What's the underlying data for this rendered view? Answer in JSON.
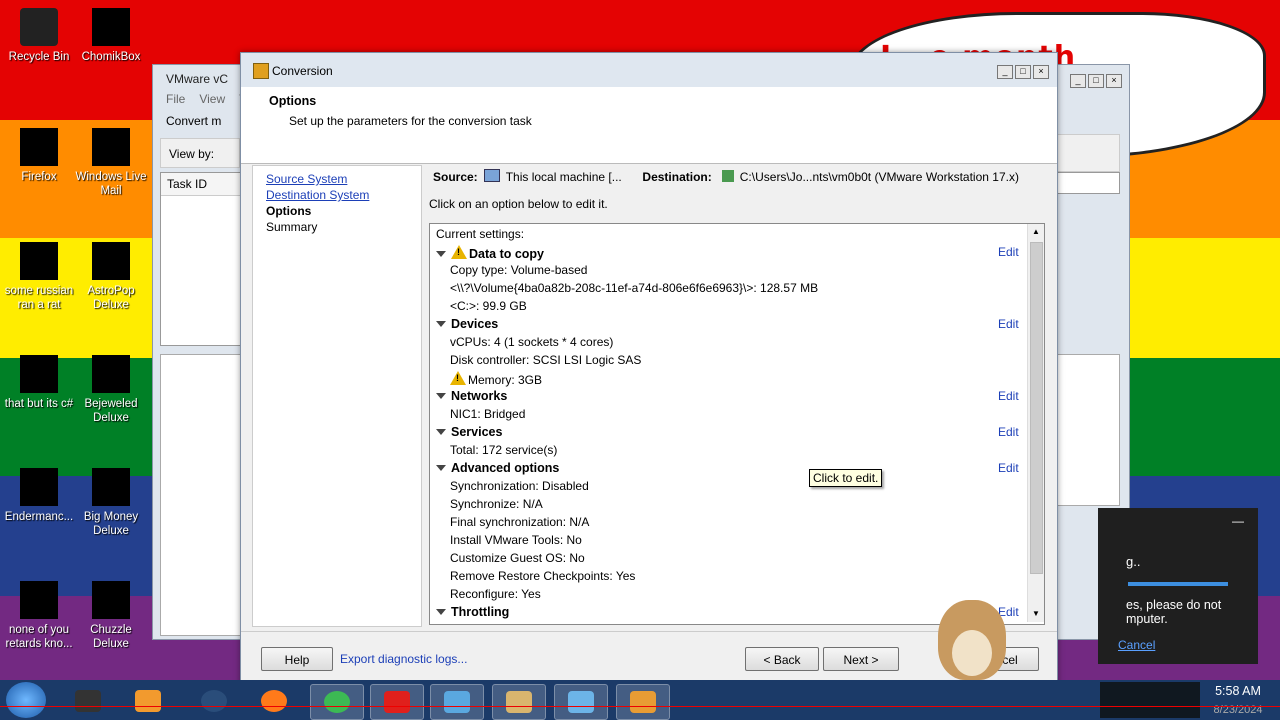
{
  "desktop": {
    "cloud_text": "I...e month",
    "icons": [
      {
        "label": "Recycle Bin"
      },
      {
        "label": "ChomikBox"
      },
      {
        "label": "Firefox"
      },
      {
        "label": "Windows Live Mail"
      },
      {
        "label": "some russian ran a rat"
      },
      {
        "label": "AstroPop Deluxe"
      },
      {
        "label": "that but its c#"
      },
      {
        "label": "Bejeweled Deluxe"
      },
      {
        "label": "Endermanc..."
      },
      {
        "label": "Big Money Deluxe"
      },
      {
        "label": "none of you retards kno..."
      },
      {
        "label": "Chuzzle Deluxe"
      }
    ]
  },
  "background_window": {
    "title": "VMware vC",
    "menu": [
      "File",
      "View",
      "T"
    ],
    "convert_label": "Convert m",
    "view_by": "View by:",
    "table_header": "Task ID"
  },
  "notification": {
    "line1": "g..",
    "line2": "es, please do not\nmputer.",
    "cancel": "Cancel",
    "minimize": "—"
  },
  "dialog": {
    "title": "Conversion",
    "header_title": "Options",
    "header_subtitle": "Set up the parameters for the conversion task",
    "nav": [
      {
        "label": "Source System",
        "state": "link"
      },
      {
        "label": "Destination System",
        "state": "link"
      },
      {
        "label": "Options",
        "state": "current"
      },
      {
        "label": "Summary",
        "state": "plain"
      }
    ],
    "source_label": "Source:",
    "source_value": "This local machine [...",
    "destination_label": "Destination:",
    "destination_value": "C:\\Users\\Jo...nts\\vm0b0t (VMware Workstation 17.x)",
    "instruction": "Click on an option below to edit it.",
    "current_settings_label": "Current settings:",
    "edit_label": "Edit",
    "sections": {
      "data_to_copy": {
        "title": "Data to copy",
        "items": [
          "Copy type: Volume-based",
          "<\\\\?\\Volume{4ba0a82b-208c-11ef-a74d-806e6f6e6963}\\>: 128.57 MB",
          "<C:>: 99.9 GB"
        ]
      },
      "devices": {
        "title": "Devices",
        "items": [
          "vCPUs: 4 (1 sockets * 4 cores)",
          "Disk controller: SCSI LSI Logic SAS",
          "Memory: 3GB"
        ]
      },
      "networks": {
        "title": "Networks",
        "items": [
          "NIC1: Bridged"
        ]
      },
      "services": {
        "title": "Services",
        "items": [
          "Total: 172 service(s)"
        ]
      },
      "advanced": {
        "title": "Advanced options",
        "items": [
          "Synchronization: Disabled",
          "Synchronize: N/A",
          "Final synchronization: N/A",
          "Install VMware Tools: No",
          "Customize Guest OS: No",
          "Remove Restore Checkpoints: Yes",
          "Reconfigure: Yes"
        ]
      },
      "throttling": {
        "title": "Throttling"
      }
    },
    "tooltip": "Click to edit.",
    "buttons": {
      "help": "Help",
      "export": "Export diagnostic logs...",
      "back": "< Back",
      "next": "Next >",
      "cancel": "cel"
    }
  },
  "taskbar": {
    "time": "5:58 AM",
    "date": "8/23/2024",
    "apps": [
      "vmware-app-icon",
      "media-player-icon",
      "steam-icon",
      "firefox-icon",
      "chrome-icon",
      "avira-icon",
      "hypercam-icon",
      "paint-icon",
      "movie-maker-icon",
      "vmware-converter-icon"
    ]
  }
}
